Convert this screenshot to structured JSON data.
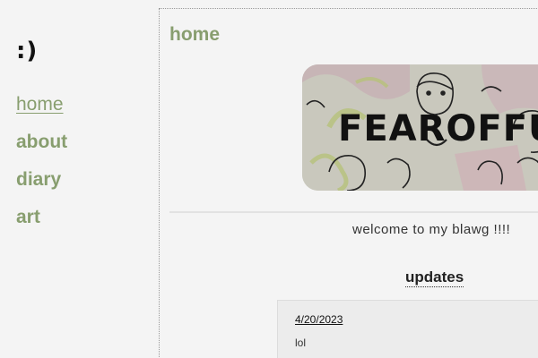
{
  "sidebar": {
    "logo": ":)",
    "items": [
      {
        "label": "home"
      },
      {
        "label": "about"
      },
      {
        "label": "diary"
      },
      {
        "label": "art"
      }
    ]
  },
  "main": {
    "title": "home",
    "banner_text": "FEAROFFUN",
    "welcome": "welcome to my blawg !!!!",
    "updates": {
      "heading": "updates",
      "entries": [
        {
          "date": "4/20/2023",
          "text": "lol"
        }
      ]
    }
  },
  "colors": {
    "accent": "#889e6f",
    "background": "#f4f4f4"
  }
}
